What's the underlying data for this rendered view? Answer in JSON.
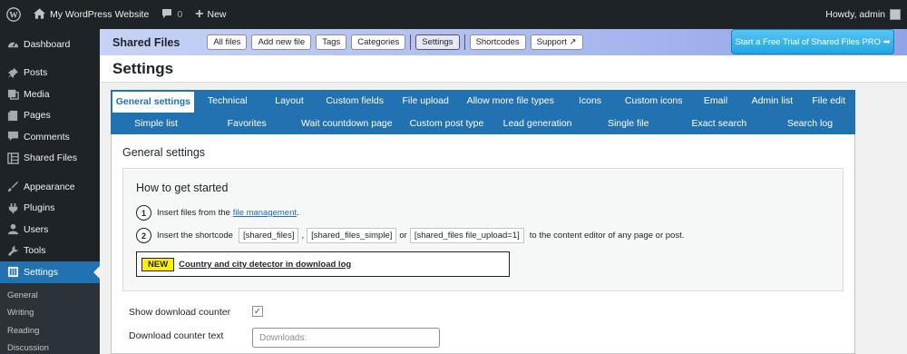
{
  "adminbar": {
    "site_name": "My WordPress Website",
    "comments_count": "0",
    "new_label": "New",
    "howdy": "Howdy, admin"
  },
  "sidebar": {
    "items": [
      {
        "label": "Dashboard",
        "icon": "dashboard-icon"
      },
      {
        "label": "Posts",
        "icon": "pin-icon"
      },
      {
        "label": "Media",
        "icon": "media-icon"
      },
      {
        "label": "Pages",
        "icon": "pages-icon"
      },
      {
        "label": "Comments",
        "icon": "comment-icon"
      },
      {
        "label": "Shared Files",
        "icon": "files-icon"
      },
      {
        "label": "Appearance",
        "icon": "brush-icon"
      },
      {
        "label": "Plugins",
        "icon": "plugin-icon"
      },
      {
        "label": "Users",
        "icon": "user-icon"
      },
      {
        "label": "Tools",
        "icon": "wrench-icon"
      },
      {
        "label": "Settings",
        "icon": "settings-icon"
      }
    ],
    "submenu": [
      "General",
      "Writing",
      "Reading",
      "Discussion"
    ]
  },
  "plugin_header": {
    "brand": "Shared Files",
    "nav": [
      "All files",
      "Add new file",
      "Tags",
      "Categories",
      "Settings",
      "Shortcodes",
      "Support ↗"
    ],
    "pro_button": "Start a Free Trial of Shared Files PRO ➡"
  },
  "page_title": "Settings",
  "tabs_row1": [
    "General settings",
    "Technical",
    "Layout",
    "Custom fields",
    "File upload",
    "Allow more file types",
    "Icons",
    "Custom icons",
    "Email",
    "Admin list",
    "File edit"
  ],
  "tabs_row2": [
    "Simple list",
    "Favorites",
    "Wait countdown page",
    "Custom post type",
    "Lead generation",
    "Single file",
    "Exact search",
    "Search log"
  ],
  "section_title": "General settings",
  "howto": {
    "title": "How to get started",
    "step1_num": "1",
    "step1_text": "Insert files from the",
    "step1_link": "file management",
    "step1_end": ".",
    "step2_num": "2",
    "step2_text": "Insert the shortcode",
    "code1": "[shared_files]",
    "comma": ",",
    "code2": "[shared_files_simple]",
    "or": "or",
    "code3": "[shared_files file_upload=1]",
    "step2_end": "to the content editor of any page or post.",
    "new_badge": "NEW",
    "new_link": "Country and city detector in download log"
  },
  "fields": {
    "show_counter_label": "Show download counter",
    "show_counter_checked": true,
    "counter_text_label": "Download counter text",
    "counter_text_placeholder": "Downloads:"
  },
  "colors": {
    "wp_blue": "#2271b1",
    "adminbar_bg": "#1d2327",
    "new_yellow": "#ffef00"
  }
}
